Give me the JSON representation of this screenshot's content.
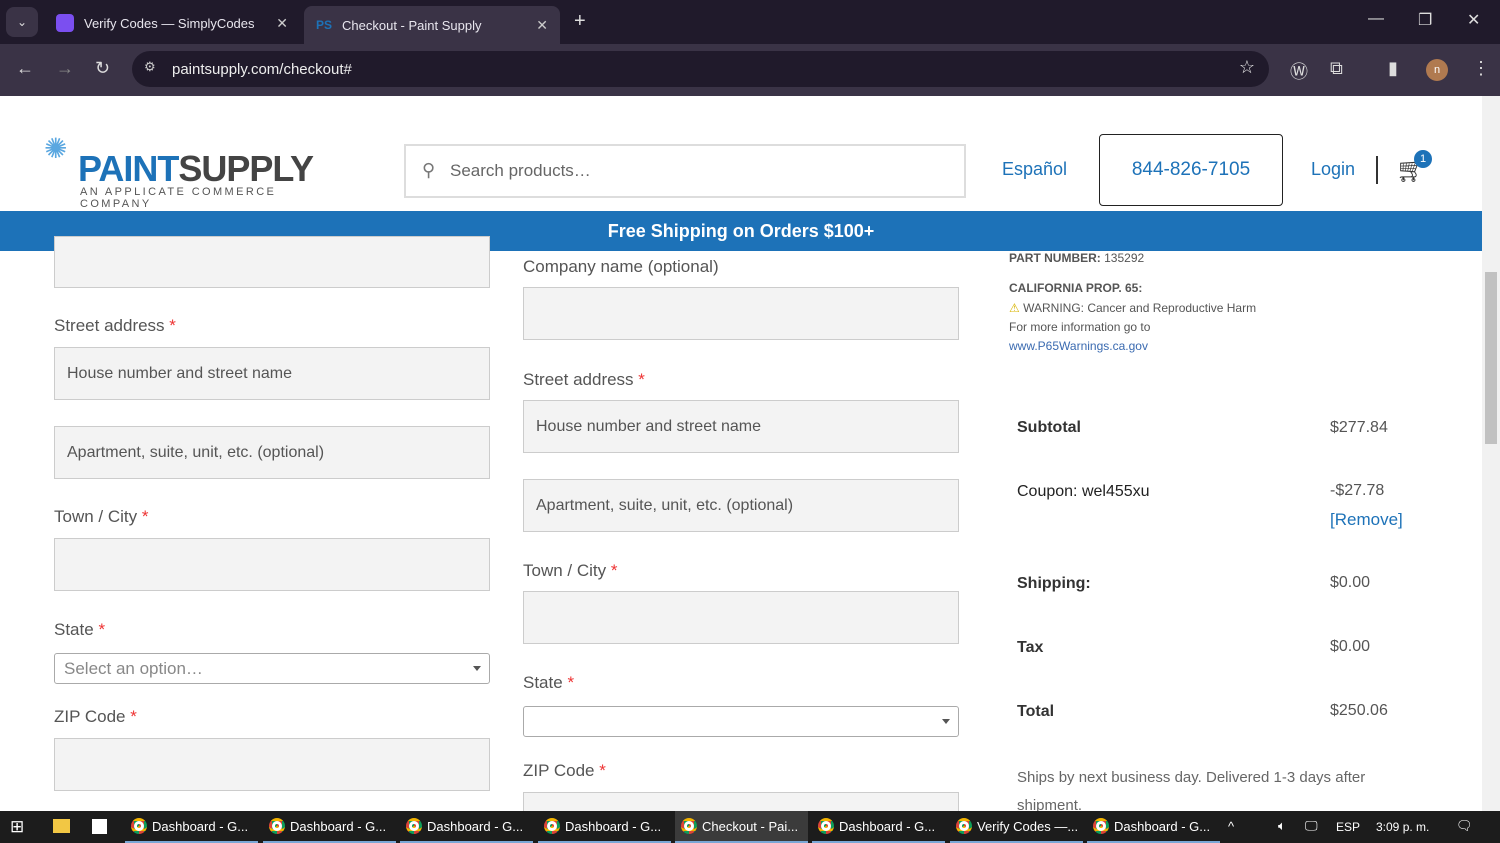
{
  "browser": {
    "tabs": [
      {
        "title": "Verify Codes — SimplyCodes",
        "active": false
      },
      {
        "title": "Checkout - Paint Supply",
        "active": true
      }
    ],
    "url": "paintsupply.com/checkout#",
    "profile_initial": "n"
  },
  "header": {
    "logo_a": "PAINT",
    "logo_b": "SUPPLY",
    "logo_tagline": "AN APPLICATE COMMERCE COMPANY",
    "search_placeholder": "Search products…",
    "language": "Español",
    "phone": "844-826-7105",
    "login": "Login",
    "cart_count": "1"
  },
  "banner": "Free Shipping on Orders $100+",
  "billing": {
    "street_label": "Street address",
    "street_placeholder": "House number and street name",
    "apt_placeholder": "Apartment, suite, unit, etc. (optional)",
    "city_label": "Town / City",
    "state_label": "State",
    "state_value": "Select an option…",
    "zip_label": "ZIP Code"
  },
  "shipping": {
    "company_label": "Company name (optional)",
    "street_label": "Street address",
    "street_placeholder": "House number and street name",
    "apt_placeholder": "Apartment, suite, unit, etc. (optional)",
    "city_label": "Town / City",
    "state_label": "State",
    "zip_label": "ZIP Code"
  },
  "product": {
    "part_label": "PART NUMBER:",
    "part_number": "135292",
    "prop_label": "CALIFORNIA PROP. 65:",
    "warning": "WARNING: Cancer and Reproductive Harm",
    "more_info": "For more information go to",
    "link": "www.P65Warnings.ca.gov"
  },
  "summary": {
    "subtotal_label": "Subtotal",
    "subtotal": "$277.84",
    "coupon_label": "Coupon: wel455xu",
    "coupon_value": "-$27.78",
    "remove": "[Remove]",
    "shipping_label": "Shipping:",
    "shipping": "$0.00",
    "tax_label": "Tax",
    "tax": "$0.00",
    "total_label": "Total",
    "total": "$250.06",
    "delivery_note": "Ships by next business day. Delivered 1-3 days after shipment."
  },
  "colors": {
    "brand_blue": "#1d72b8",
    "required": "#e33333"
  },
  "taskbar": {
    "items": [
      "Dashboard - G...",
      "Dashboard - G...",
      "Dashboard - G...",
      "Dashboard - G...",
      "Checkout - Pai...",
      "Dashboard - G...",
      "Verify Codes —...",
      "Dashboard - G..."
    ],
    "lang": "ESP",
    "time": "3:09 p. m."
  }
}
